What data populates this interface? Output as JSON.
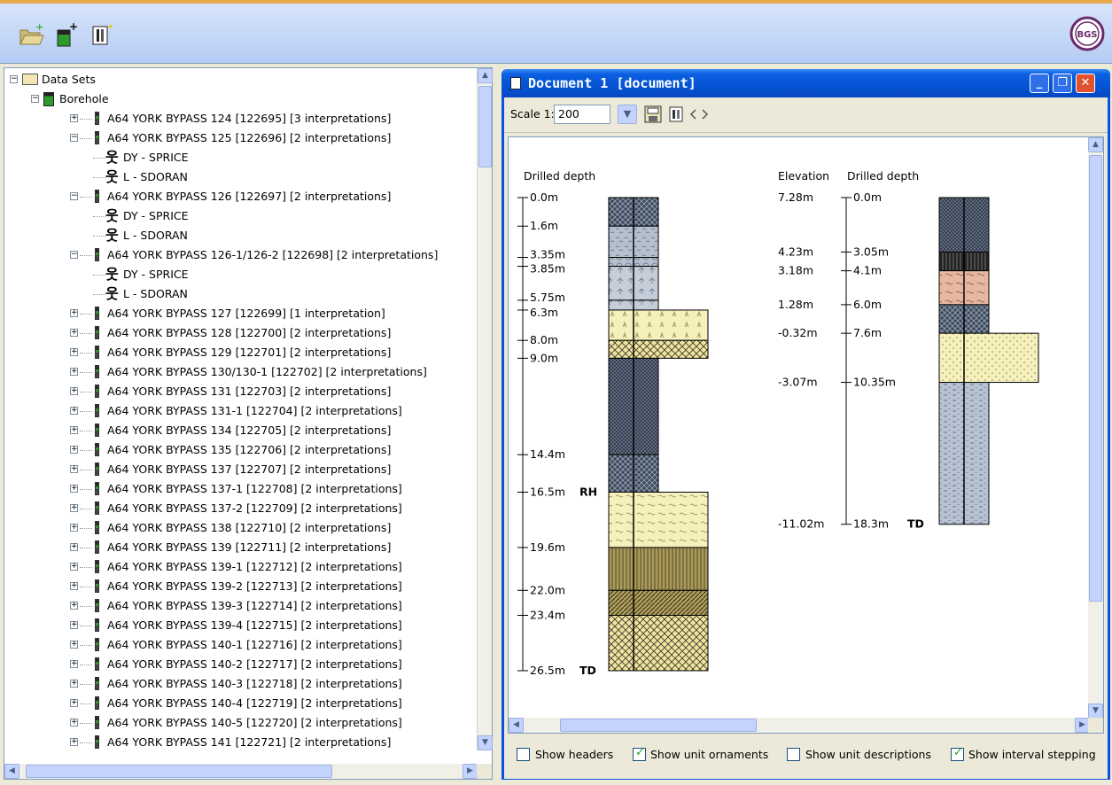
{
  "toolbar": {
    "icons": [
      "open-folder-add-icon",
      "add-borehole-icon",
      "new-document-icon"
    ],
    "logo_text": "BGS"
  },
  "tree": {
    "root": "Data Sets",
    "group": "Borehole",
    "rows": [
      {
        "label": "A64 YORK BYPASS 124 [122695] [3 interpretations]",
        "type": "bh",
        "expanded": false
      },
      {
        "label": "A64 YORK BYPASS 125 [122696] [2 interpretations]",
        "type": "bh",
        "expanded": true
      },
      {
        "label": "DY - SPRICE",
        "type": "person"
      },
      {
        "label": "L - SDORAN",
        "type": "person"
      },
      {
        "label": "A64 YORK BYPASS 126 [122697] [2 interpretations]",
        "type": "bh",
        "expanded": true
      },
      {
        "label": "DY - SPRICE",
        "type": "person"
      },
      {
        "label": "L - SDORAN",
        "type": "person"
      },
      {
        "label": "A64 YORK BYPASS 126-1/126-2 [122698] [2 interpretations]",
        "type": "bh",
        "expanded": true
      },
      {
        "label": "DY - SPRICE",
        "type": "person"
      },
      {
        "label": "L - SDORAN",
        "type": "person"
      },
      {
        "label": "A64 YORK BYPASS 127 [122699] [1 interpretation]",
        "type": "bh",
        "expanded": false
      },
      {
        "label": "A64 YORK BYPASS 128 [122700] [2 interpretations]",
        "type": "bh",
        "expanded": false
      },
      {
        "label": "A64 YORK BYPASS 129 [122701] [2 interpretations]",
        "type": "bh",
        "expanded": false
      },
      {
        "label": "A64 YORK BYPASS 130/130-1 [122702] [2 interpretations]",
        "type": "bh",
        "expanded": false
      },
      {
        "label": "A64 YORK BYPASS 131 [122703] [2 interpretations]",
        "type": "bh",
        "expanded": false
      },
      {
        "label": "A64 YORK BYPASS 131-1 [122704] [2 interpretations]",
        "type": "bh",
        "expanded": false
      },
      {
        "label": "A64 YORK BYPASS 134 [122705] [2 interpretations]",
        "type": "bh",
        "expanded": false
      },
      {
        "label": "A64 YORK BYPASS 135 [122706] [2 interpretations]",
        "type": "bh",
        "expanded": false
      },
      {
        "label": "A64 YORK BYPASS 137 [122707] [2 interpretations]",
        "type": "bh",
        "expanded": false
      },
      {
        "label": "A64 YORK BYPASS 137-1 [122708] [2 interpretations]",
        "type": "bh",
        "expanded": false
      },
      {
        "label": "A64 YORK BYPASS 137-2 [122709] [2 interpretations]",
        "type": "bh",
        "expanded": false
      },
      {
        "label": "A64 YORK BYPASS 138 [122710] [2 interpretations]",
        "type": "bh",
        "expanded": false
      },
      {
        "label": "A64 YORK BYPASS 139 [122711] [2 interpretations]",
        "type": "bh",
        "expanded": false
      },
      {
        "label": "A64 YORK BYPASS 139-1 [122712] [2 interpretations]",
        "type": "bh",
        "expanded": false
      },
      {
        "label": "A64 YORK BYPASS 139-2 [122713] [2 interpretations]",
        "type": "bh",
        "expanded": false
      },
      {
        "label": "A64 YORK BYPASS 139-3 [122714] [2 interpretations]",
        "type": "bh",
        "expanded": false
      },
      {
        "label": "A64 YORK BYPASS 139-4 [122715] [2 interpretations]",
        "type": "bh",
        "expanded": false
      },
      {
        "label": "A64 YORK BYPASS 140-1 [122716] [2 interpretations]",
        "type": "bh",
        "expanded": false
      },
      {
        "label": "A64 YORK BYPASS 140-2 [122717] [2 interpretations]",
        "type": "bh",
        "expanded": false
      },
      {
        "label": "A64 YORK BYPASS 140-3 [122718] [2 interpretations]",
        "type": "bh",
        "expanded": false
      },
      {
        "label": "A64 YORK BYPASS 140-4 [122719] [2 interpretations]",
        "type": "bh",
        "expanded": false
      },
      {
        "label": "A64 YORK BYPASS 140-5 [122720] [2 interpretations]",
        "type": "bh",
        "expanded": false
      },
      {
        "label": "A64 YORK BYPASS 141 [122721] [2 interpretations]",
        "type": "bh",
        "expanded": false
      }
    ]
  },
  "document": {
    "title": "Document 1 [document]",
    "scale_label": "Scale 1:",
    "scale_value": "200",
    "log1": {
      "header": "Drilled depth",
      "depths": [
        "0.0m",
        "1.6m",
        "3.35m",
        "3.85m",
        "5.75m",
        "6.3m",
        "8.0m",
        "9.0m",
        "14.4m",
        "16.5m",
        "19.6m",
        "22.0m",
        "23.4m",
        "26.5m"
      ],
      "rh_label": "RH",
      "td_label": "TD"
    },
    "log2": {
      "elevation_header": "Elevation",
      "depth_header": "Drilled depth",
      "elevations": [
        "7.28m",
        "4.23m",
        "3.18m",
        "1.28m",
        "-0.32m",
        "-3.07m",
        "-11.02m"
      ],
      "depths": [
        "0.0m",
        "3.05m",
        "4.1m",
        "6.0m",
        "7.6m",
        "10.35m",
        "18.3m"
      ],
      "td_label": "TD"
    },
    "footer": {
      "show_headers": {
        "label": "Show headers",
        "checked": false
      },
      "show_unit_ornaments": {
        "label": "Show unit ornaments",
        "checked": true
      },
      "show_unit_descriptions": {
        "label": "Show unit descriptions",
        "checked": false
      },
      "show_interval_stepping": {
        "label": "Show interval stepping",
        "checked": true
      }
    }
  },
  "colors": {
    "title_blue": "#0553d4",
    "dark_lattice": "#3d4a5c",
    "grey_lattice": "#a9b4c2",
    "sand": "#f6f0bd",
    "olive": "#a99a58",
    "pink": "#e7b8a0"
  }
}
